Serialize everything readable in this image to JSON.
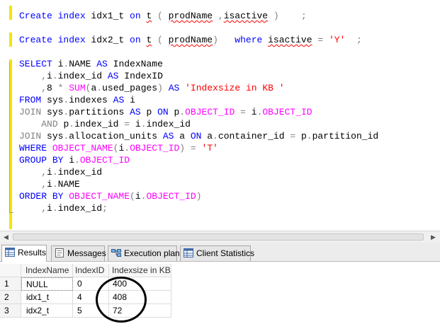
{
  "editor": {
    "lines": [
      [
        [
          "kw",
          "Create "
        ],
        [
          "kw",
          "index "
        ],
        [
          "pl",
          "idx1_t "
        ],
        [
          "kw",
          "on "
        ],
        [
          "sq",
          "t"
        ],
        [
          "gr",
          " ( "
        ],
        [
          "sq",
          "prodName"
        ],
        [
          "pl",
          " "
        ],
        [
          "gr",
          ","
        ],
        [
          "sq",
          "isactive"
        ],
        [
          "gr",
          " )"
        ],
        [
          "pl",
          "    "
        ],
        [
          "gr",
          ";"
        ]
      ],
      [],
      [
        [
          "kw",
          "Create "
        ],
        [
          "kw",
          "index "
        ],
        [
          "pl",
          "idx2_t "
        ],
        [
          "kw",
          "on "
        ],
        [
          "sq",
          "t"
        ],
        [
          "gr",
          " ( "
        ],
        [
          "sq",
          "prodName"
        ],
        [
          "gr",
          ")"
        ],
        [
          "pl",
          "   "
        ],
        [
          "kw",
          "where "
        ],
        [
          "sq",
          "isactive"
        ],
        [
          "pl",
          " "
        ],
        [
          "gr",
          "="
        ],
        [
          "pl",
          " "
        ],
        [
          "str",
          "'Y'"
        ],
        [
          "pl",
          "  "
        ],
        [
          "gr",
          ";"
        ]
      ],
      [],
      [
        [
          "kw",
          "SELECT "
        ],
        [
          "pl",
          "i"
        ],
        [
          "gr",
          "."
        ],
        [
          "pl",
          "NAME "
        ],
        [
          "kw",
          "AS "
        ],
        [
          "pl",
          "IndexName"
        ]
      ],
      [
        [
          "pl",
          "    "
        ],
        [
          "gr",
          ","
        ],
        [
          "pl",
          "i"
        ],
        [
          "gr",
          "."
        ],
        [
          "pl",
          "index_id "
        ],
        [
          "kw",
          "AS "
        ],
        [
          "pl",
          "IndexID"
        ]
      ],
      [
        [
          "pl",
          "    "
        ],
        [
          "gr",
          ","
        ],
        [
          "pl",
          "8 "
        ],
        [
          "gr",
          "* "
        ],
        [
          "fn",
          "SUM"
        ],
        [
          "gr",
          "("
        ],
        [
          "pl",
          "a"
        ],
        [
          "gr",
          "."
        ],
        [
          "pl",
          "used_pages"
        ],
        [
          "gr",
          ") "
        ],
        [
          "kw",
          "AS "
        ],
        [
          "str",
          "'Indexsize in KB '"
        ]
      ],
      [
        [
          "kw",
          "FROM "
        ],
        [
          "pl",
          "sys"
        ],
        [
          "gr",
          "."
        ],
        [
          "pl",
          "indexes "
        ],
        [
          "kw",
          "AS "
        ],
        [
          "pl",
          "i"
        ]
      ],
      [
        [
          "gr",
          "JOIN "
        ],
        [
          "pl",
          "sys"
        ],
        [
          "gr",
          "."
        ],
        [
          "pl",
          "partitions "
        ],
        [
          "kw",
          "AS "
        ],
        [
          "pl",
          "p "
        ],
        [
          "kw",
          "ON "
        ],
        [
          "pl",
          "p"
        ],
        [
          "gr",
          "."
        ],
        [
          "fn",
          "OBJECT_ID"
        ],
        [
          "pl",
          " "
        ],
        [
          "gr",
          "="
        ],
        [
          "pl",
          " i"
        ],
        [
          "gr",
          "."
        ],
        [
          "fn",
          "OBJECT_ID"
        ]
      ],
      [
        [
          "pl",
          "    "
        ],
        [
          "gr",
          "AND "
        ],
        [
          "pl",
          "p"
        ],
        [
          "gr",
          "."
        ],
        [
          "pl",
          "index_id "
        ],
        [
          "gr",
          "="
        ],
        [
          "pl",
          " i"
        ],
        [
          "gr",
          "."
        ],
        [
          "pl",
          "index_id"
        ]
      ],
      [
        [
          "gr",
          "JOIN "
        ],
        [
          "pl",
          "sys"
        ],
        [
          "gr",
          "."
        ],
        [
          "pl",
          "allocation_units "
        ],
        [
          "kw",
          "AS "
        ],
        [
          "pl",
          "a "
        ],
        [
          "kw",
          "ON "
        ],
        [
          "pl",
          "a"
        ],
        [
          "gr",
          "."
        ],
        [
          "pl",
          "container_id "
        ],
        [
          "gr",
          "="
        ],
        [
          "pl",
          " p"
        ],
        [
          "gr",
          "."
        ],
        [
          "pl",
          "partition_id"
        ]
      ],
      [
        [
          "kw",
          "WHERE "
        ],
        [
          "fn",
          "OBJECT_NAME"
        ],
        [
          "gr",
          "("
        ],
        [
          "pl",
          "i"
        ],
        [
          "gr",
          "."
        ],
        [
          "fn",
          "OBJECT_ID"
        ],
        [
          "gr",
          ")"
        ],
        [
          "pl",
          " "
        ],
        [
          "gr",
          "="
        ],
        [
          "pl",
          " "
        ],
        [
          "str",
          "'T'"
        ]
      ],
      [
        [
          "kw",
          "GROUP "
        ],
        [
          "kw",
          "BY "
        ],
        [
          "pl",
          "i"
        ],
        [
          "gr",
          "."
        ],
        [
          "fn",
          "OBJECT_ID"
        ]
      ],
      [
        [
          "pl",
          "    "
        ],
        [
          "gr",
          ","
        ],
        [
          "pl",
          "i"
        ],
        [
          "gr",
          "."
        ],
        [
          "pl",
          "index_id"
        ]
      ],
      [
        [
          "pl",
          "    "
        ],
        [
          "gr",
          ","
        ],
        [
          "pl",
          "i"
        ],
        [
          "gr",
          "."
        ],
        [
          "pl",
          "NAME"
        ]
      ],
      [
        [
          "kw",
          "ORDER "
        ],
        [
          "kw",
          "BY "
        ],
        [
          "fn",
          "OBJECT_NAME"
        ],
        [
          "gr",
          "("
        ],
        [
          "pl",
          "i"
        ],
        [
          "gr",
          "."
        ],
        [
          "fn",
          "OBJECT_ID"
        ],
        [
          "gr",
          ")"
        ]
      ],
      [
        [
          "pl",
          "    "
        ],
        [
          "gr",
          ","
        ],
        [
          "pl",
          "i"
        ],
        [
          "gr",
          "."
        ],
        [
          "pl",
          "index_id"
        ],
        [
          "gr",
          ";"
        ]
      ]
    ]
  },
  "tabs": [
    {
      "label": "Results",
      "icon": "results-grid-icon",
      "active": true
    },
    {
      "label": "Messages",
      "icon": "messages-icon",
      "active": false
    },
    {
      "label": "Execution plan",
      "icon": "execution-plan-icon",
      "active": false
    },
    {
      "label": "Client Statistics",
      "icon": "client-statistics-icon",
      "active": false
    }
  ],
  "results": {
    "columns": [
      "IndexName",
      "IndexID",
      "Indexsize in KB"
    ],
    "rows": [
      {
        "num": "1",
        "cells": [
          "NULL",
          "0",
          "400"
        ]
      },
      {
        "num": "2",
        "cells": [
          "idx1_t",
          "4",
          "408"
        ]
      },
      {
        "num": "3",
        "cells": [
          "idx2_t",
          "5",
          "72"
        ]
      }
    ]
  },
  "colors": {
    "keyword": "#0000ff",
    "function": "#ff00ff",
    "string": "#ff0000",
    "operator": "#808080"
  }
}
